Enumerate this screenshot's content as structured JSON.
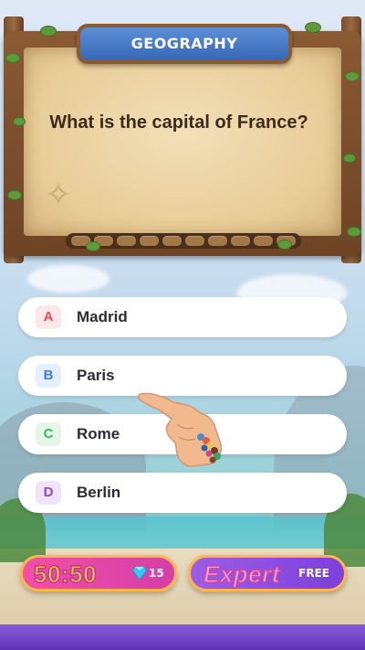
{
  "category": {
    "title": "GEOGRAPHY"
  },
  "question": {
    "text": "What is the capital of France?",
    "progress_segments": 10
  },
  "answers": [
    {
      "letter": "A",
      "label": "Madrid",
      "color": "#ef4b55",
      "bg": "#fde7e8"
    },
    {
      "letter": "B",
      "label": "Paris",
      "color": "#3f7fe0",
      "bg": "#e5efff"
    },
    {
      "letter": "C",
      "label": "Rome",
      "color": "#3db85b",
      "bg": "#e4f6e8"
    },
    {
      "letter": "D",
      "label": "Berlin",
      "color": "#8b4bd9",
      "bg": "#efe4fb"
    }
  ],
  "powerups": {
    "fifty": {
      "label": "50:50",
      "cost": "15",
      "icon": "gem-icon"
    },
    "expert": {
      "label": "Expert",
      "price": "FREE"
    }
  }
}
